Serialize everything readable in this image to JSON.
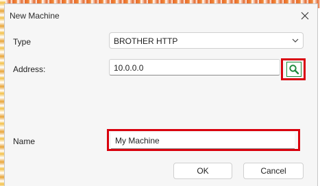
{
  "dialog": {
    "title": "New Machine",
    "type_label": "Type",
    "type_value": "BROTHER HTTP",
    "address_label": "Address:",
    "address_value": "10.0.0.0",
    "name_label": "Name",
    "name_value": "My Machine",
    "ok_label": "OK",
    "cancel_label": "Cancel"
  },
  "icons": {
    "close": "close-icon",
    "dropdown": "chevron-down-icon",
    "lookup": "search-icon"
  },
  "colors": {
    "highlight": "#d9000d",
    "lookup_accent": "#1e8a3c"
  }
}
